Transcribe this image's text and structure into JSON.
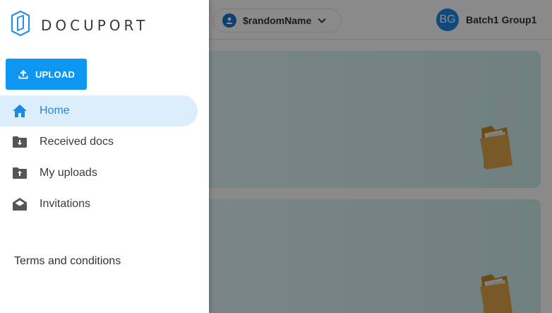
{
  "header": {
    "user_select_label": "$randomName",
    "avatar_initials": "BG",
    "account_name": "Batch1 Group1"
  },
  "drawer": {
    "logo_text": "DOCUPORT",
    "upload_label": "UPLOAD",
    "nav": [
      {
        "label": "Home",
        "icon": "home-icon",
        "active": true
      },
      {
        "label": "Received docs",
        "icon": "folder-download-icon",
        "active": false
      },
      {
        "label": "My uploads",
        "icon": "folder-upload-icon",
        "active": false
      },
      {
        "label": "Invitations",
        "icon": "envelope-open-icon",
        "active": false
      }
    ],
    "terms_label": "Terms and conditions"
  },
  "colors": {
    "primary": "#0d96f2",
    "active_nav_bg": "#dceefc",
    "active_nav_text": "#1a8be0",
    "avatar": "#1e88e5"
  }
}
